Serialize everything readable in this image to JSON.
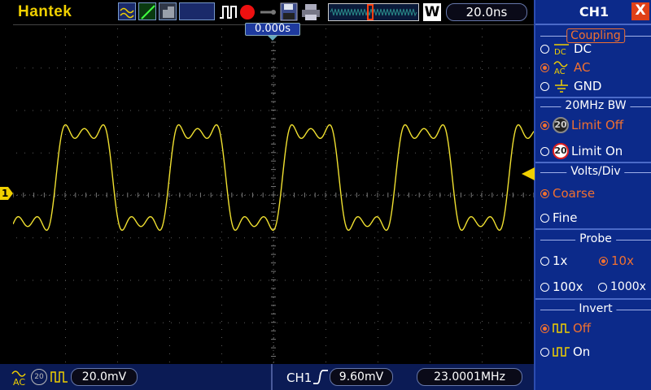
{
  "header": {
    "brand": "Hantek",
    "timebase": "20.0ns",
    "window_label": "W",
    "trigger_position": "0.000s",
    "icons": [
      "waveform-icon",
      "slope-icon",
      "persist-icon",
      "run-trigger-icon",
      "record-stop-icon",
      "key-icon",
      "save-icon",
      "print-icon"
    ]
  },
  "waveform": {
    "channel": "CH1",
    "channel_marker": "1",
    "color": "#f0e030"
  },
  "footer": {
    "coupling_icons": [
      "ac-coupling-icon",
      "bw-limit-icon",
      "invert-icon"
    ],
    "volts_div": "20.0mV",
    "trigger_source": "CH1",
    "trigger_level": "9.60mV",
    "frequency": "23.0001MHz"
  },
  "menu": {
    "title": "CH1",
    "close_label": "X",
    "coupling": {
      "title": "Coupling",
      "options": [
        {
          "label": "DC",
          "selected": false
        },
        {
          "label": "AC",
          "selected": true
        },
        {
          "label": "GND",
          "selected": false
        }
      ]
    },
    "bandwidth": {
      "title": "20MHz BW",
      "badge": "20",
      "options": [
        {
          "label": "Limit Off",
          "selected": true
        },
        {
          "label": "Limit On",
          "selected": false
        }
      ]
    },
    "volts_div": {
      "title": "Volts/Div",
      "options": [
        {
          "label": "Coarse",
          "selected": true
        },
        {
          "label": "Fine",
          "selected": false
        }
      ]
    },
    "probe": {
      "title": "Probe",
      "options": [
        {
          "label": "1x",
          "selected": false
        },
        {
          "label": "10x",
          "selected": true
        },
        {
          "label": "100x",
          "selected": false
        },
        {
          "label": "1000x",
          "selected": false
        }
      ]
    },
    "invert": {
      "title": "Invert",
      "options": [
        {
          "label": "Off",
          "selected": true
        },
        {
          "label": "On",
          "selected": false
        }
      ]
    }
  },
  "colors": {
    "brand": "#f0d000",
    "trace": "#f0e030",
    "menu_bg": "#0c2a8a",
    "selected": "#f07030",
    "footer_bg": "#0b1b55"
  }
}
